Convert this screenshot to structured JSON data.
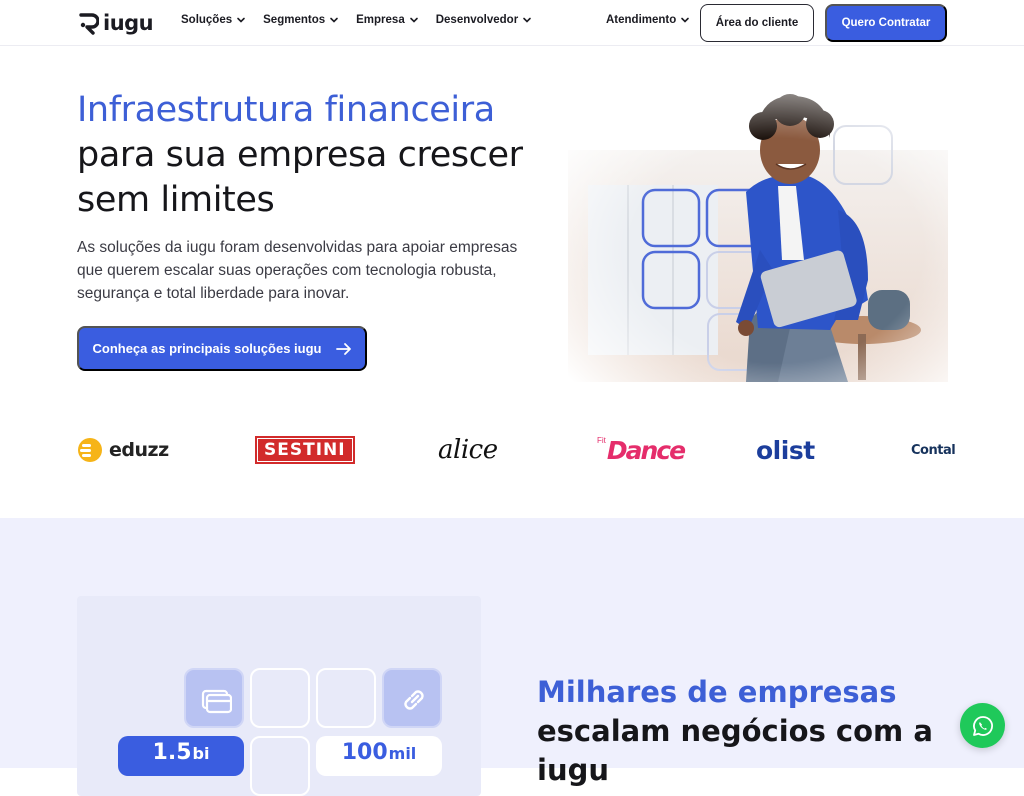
{
  "header": {
    "logo_text": "iugu",
    "nav": [
      {
        "label": "Soluções"
      },
      {
        "label": "Segmentos"
      },
      {
        "label": "Empresa"
      },
      {
        "label": "Desenvolvedor"
      }
    ],
    "support_label": "Atendimento",
    "client_area_label": "Área do cliente",
    "hire_label": "Quero Contratar"
  },
  "hero": {
    "title_accent": "Infraestrutura financeira",
    "title_line2": "para sua empresa crescer",
    "title_line3": "sem limites",
    "description": "As soluções da iugu foram desenvolvidas para apoiar empresas que querem escalar suas operações com tecnologia robusta, segurança e total liberdade para inovar.",
    "cta_label": "Conheça as principais soluções iugu"
  },
  "logos": {
    "eduzz": "eduzz",
    "sestini": "SESTINI",
    "alice": "alice",
    "dance_prefix": "Fit",
    "dance": "Dance",
    "olist": "olist",
    "contal": "Contal"
  },
  "stats": {
    "stat1_value": "1.5",
    "stat1_unit": "bi",
    "stat2_value": "100",
    "stat2_unit": "mil",
    "title_accent": "Milhares de empresas",
    "title_line2": "escalam negócios com a",
    "title_line3": "iugu"
  },
  "colors": {
    "brand_blue": "#3a5de0",
    "accent_text": "#3d5fd6",
    "section_bg": "#eff0fd",
    "whatsapp_green": "#1fc95a"
  }
}
